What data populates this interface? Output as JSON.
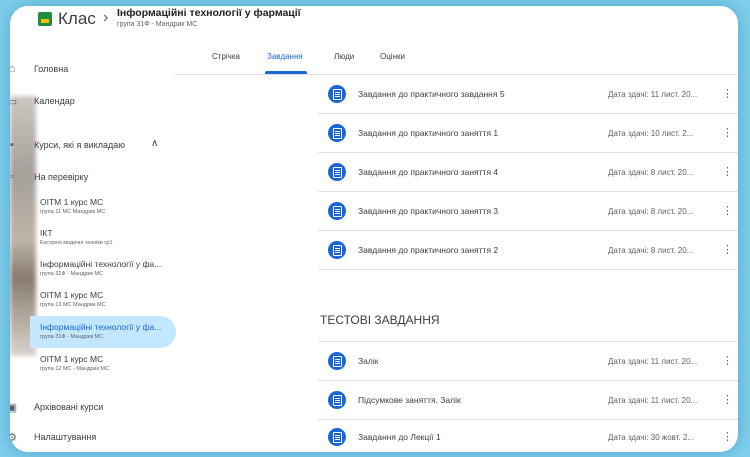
{
  "header": {
    "app_name": "Клас",
    "chevron": "›",
    "class_title": "Інформаційні технології у фармації",
    "class_subtitle": "група 31Ф - Мандрик МС"
  },
  "sidebar": {
    "items": [
      {
        "icon": "home-icon",
        "label": "Головна"
      },
      {
        "icon": "calendar-icon",
        "label": "Календар"
      },
      {
        "icon": "teaching-icon",
        "label": "Курси, які я викладаю"
      }
    ],
    "review": {
      "icon": "review-icon",
      "label": "На перевірку"
    },
    "courses": [
      {
        "title": "ОІТМ 1 курс МС",
        "subtitle": "група 11 МС Мандрик МС"
      },
      {
        "title": "ІКТ",
        "subtitle": "Екстрені медичні техніки гр1"
      },
      {
        "title": "Інформаційні технології у фа...",
        "subtitle": "група 32Ф - Мандрик МС"
      },
      {
        "title": "ОІТМ 1 курс МС",
        "subtitle": "група 13 МС Мандрик МС"
      },
      {
        "title": "Інформаційні технології у фа...",
        "subtitle": "група 31Ф - Мандрик МС"
      },
      {
        "title": "ОІТМ 1 курс МС",
        "subtitle": "група 12 МС - Мандрик МС"
      }
    ],
    "archived": {
      "icon": "archive-icon",
      "label": "Архівовані курси"
    },
    "settings": {
      "icon": "gear-icon",
      "label": "Налаштування"
    }
  },
  "tabs": [
    "Стрічка",
    "Завдання",
    "Люди",
    "Оцінки"
  ],
  "assignments": [
    {
      "title": "Завдання до практичного завдання 5",
      "due": "Дата здачі: 11 лист. 20..."
    },
    {
      "title": "Завдання до практичного заняття 1",
      "due": "Дата здачі: 10 лист. 2..."
    },
    {
      "title": "Завдання до практичного заняття 4",
      "due": "Дата здачі: 8 лист. 20..."
    },
    {
      "title": "Завдання до практичного заняття 3",
      "due": "Дата здачі: 8 лист. 20..."
    },
    {
      "title": "Завдання до практичного заняття 2",
      "due": "Дата здачі: 8 лист. 20..."
    }
  ],
  "section": {
    "title": "ТЕСТОВІ ЗАВДАННЯ"
  },
  "tests": [
    {
      "title": "Залік",
      "due": "Дата здачі: 11 лист. 20..."
    },
    {
      "title": "Підсумкове заняття. Залік",
      "due": "Дата здачі: 11 лист. 20..."
    },
    {
      "title": "Завдання до Лекції 1",
      "due": "Дата здачі: 30 жовт. 2..."
    }
  ],
  "colors": {
    "accent": "#1967d2",
    "active_bg": "#c2e7ff",
    "logo": "#1e8e3e"
  }
}
